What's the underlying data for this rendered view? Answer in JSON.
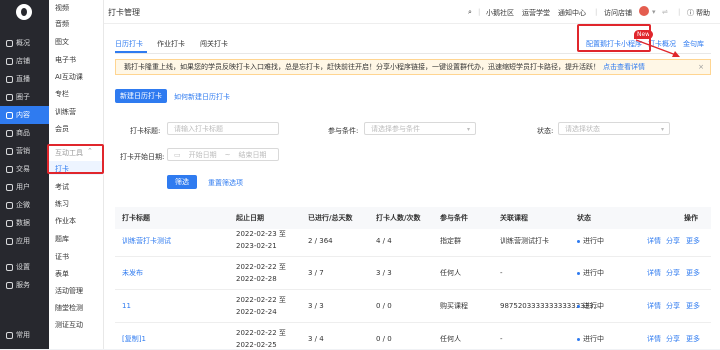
{
  "nav": {
    "items": [
      {
        "label": "概况",
        "icon": "dashboard-icon"
      },
      {
        "label": "店铺",
        "icon": "shop-icon"
      },
      {
        "label": "直播",
        "icon": "live-icon"
      },
      {
        "label": "内容",
        "icon": "content-icon"
      },
      {
        "label": "商品",
        "icon": "goods-icon"
      },
      {
        "label": "营销",
        "icon": "marketing-icon"
      },
      {
        "label": "圈子",
        "icon": "circle-icon"
      },
      {
        "label": "交易",
        "icon": "trade-icon"
      },
      {
        "label": "用户",
        "icon": "user-icon"
      },
      {
        "label": "企微",
        "icon": "wecom-icon"
      },
      {
        "label": "数据",
        "icon": "data-icon"
      },
      {
        "label": "应用",
        "icon": "apps-icon"
      },
      {
        "label": "设置",
        "icon": "settings-icon"
      },
      {
        "label": "服务",
        "icon": "service-icon"
      },
      {
        "label": "常用",
        "icon": "frequent-icon"
      }
    ]
  },
  "submenu": {
    "items": [
      "视频",
      "音频",
      "图文",
      "电子书",
      "AI互动课",
      "专栏",
      "训练营",
      "会员"
    ],
    "group": "互动工具",
    "group_items": [
      "打卡",
      "考试",
      "练习",
      "作业本",
      "题库",
      "证书",
      "表单",
      "活动管理",
      "随堂检测",
      "测证互动"
    ]
  },
  "header": {
    "title": "打卡管理",
    "links": [
      "小鹅社区",
      "运营学堂",
      "通知中心",
      "访问店铺",
      "帮助"
    ]
  },
  "tabs": [
    "日历打卡",
    "作业打卡",
    "闯关打卡"
  ],
  "right_links": {
    "config": "配置鹅打卡小程序",
    "new_badge": "New",
    "overview": "打卡概况",
    "wallet": "金句库"
  },
  "notice": {
    "text": "鹅打卡隆重上线，如果您的学员反映打卡入口难找，总是忘打卡，赶快前往开启！分享小程序链接，一键设置群代办，迅速缩短学员打卡路径，提升活跃！",
    "link": "点击查看详情",
    "close": "×"
  },
  "actions": {
    "create": "新建日历打卡",
    "howto": "如何新建日历打卡"
  },
  "filters": {
    "title_label": "打卡标题:",
    "title_placeholder": "请输入打卡标题",
    "cond_label": "参与条件:",
    "cond_placeholder": "请选择参与条件",
    "status_label": "状态:",
    "status_placeholder": "请选择状态",
    "date_label": "打卡开始日期:",
    "start_placeholder": "开始日期",
    "date_sep": "~",
    "end_placeholder": "结束日期",
    "search": "筛选",
    "reset": "重置筛选项"
  },
  "table": {
    "columns": [
      "打卡标题",
      "起止日期",
      "已进行/总天数",
      "打卡人数/次数",
      "参与条件",
      "关联课程",
      "状态",
      "操作"
    ],
    "rows": [
      {
        "title": "训练营打卡测试",
        "start": "2022-02-23 至",
        "end": "2023-02-21",
        "progress": "2 / 364",
        "count": "4 / 4",
        "cond": "指定群",
        "course": "训练营测试打卡",
        "status": "进行中"
      },
      {
        "title": "未发布",
        "start": "2022-02-22 至",
        "end": "2022-02-28",
        "progress": "3 / 7",
        "count": "3 / 3",
        "cond": "任何人",
        "course": "-",
        "status": "进行中"
      },
      {
        "title": "11",
        "start": "2022-02-22 至",
        "end": "2022-02-24",
        "progress": "3 / 3",
        "count": "0 / 0",
        "cond": "购买课程",
        "course": "987520333333333333333...",
        "status": "进行中"
      },
      {
        "title": "[复制]1",
        "start": "2022-02-22 至",
        "end": "2022-02-25",
        "progress": "3 / 4",
        "count": "0 / 0",
        "cond": "任何人",
        "course": "-",
        "status": "进行中"
      }
    ],
    "ops": [
      "详情",
      "分享",
      "更多"
    ]
  }
}
